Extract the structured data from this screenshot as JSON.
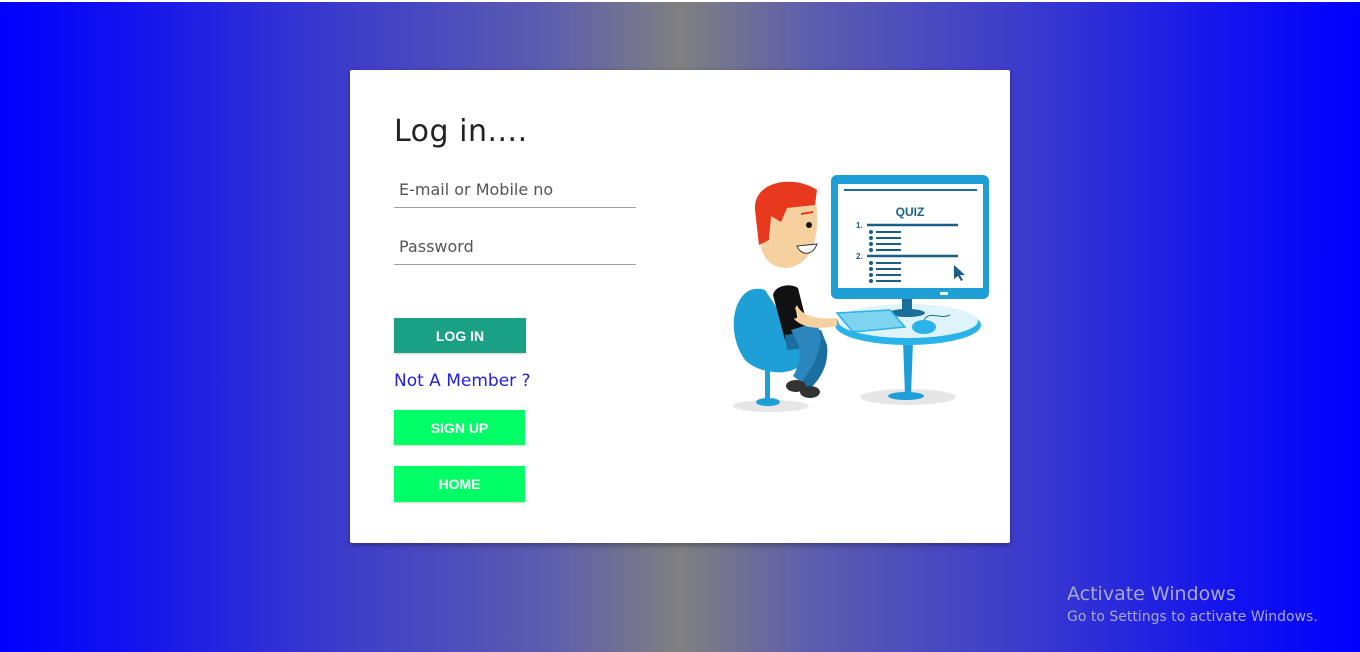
{
  "login": {
    "title": "Log in....",
    "email_placeholder": "E-mail or Mobile no",
    "password_placeholder": "Password",
    "login_button": "LOG IN",
    "member_link": "Not A Member ?",
    "signup_button": "SIGN UP",
    "home_button": "HOME"
  },
  "illustration": {
    "screen_title": "QUIZ",
    "item_1": "1.",
    "item_2": "2."
  },
  "watermark": {
    "title": "Activate Windows",
    "subtitle": "Go to Settings to activate Windows."
  },
  "colors": {
    "login_button": "#1aa085",
    "signup_button": "#00ff66",
    "link": "#2222dd",
    "background_edge": "#0000ff"
  }
}
